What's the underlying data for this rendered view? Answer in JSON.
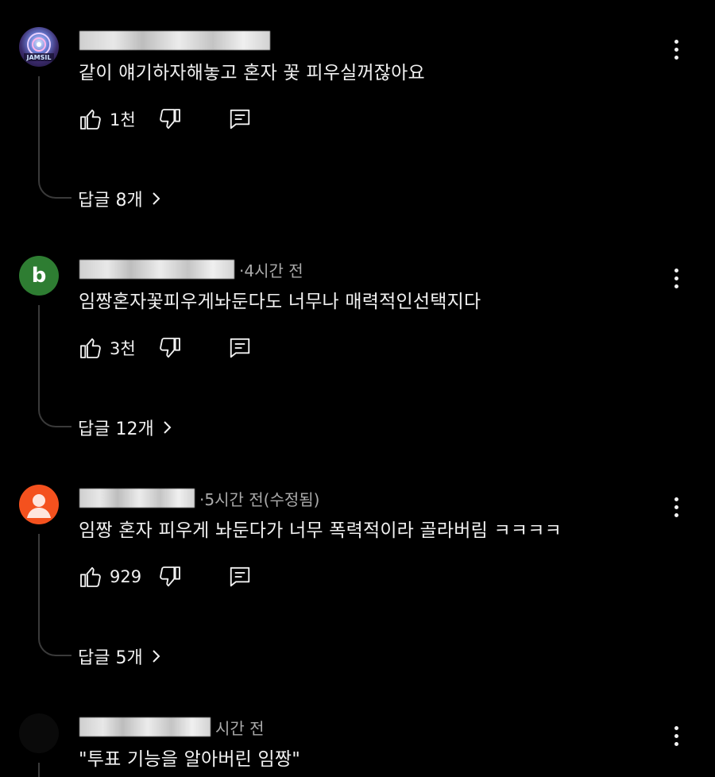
{
  "comments": [
    {
      "avatar_type": "image",
      "avatar_text": "JAMSIL",
      "meta_suffix": "",
      "text": "같이 얘기하자해놓고 혼자 꽃 피우실꺼잖아요",
      "likes": "1천",
      "replies_label": "답글 8개"
    },
    {
      "avatar_type": "letter",
      "avatar_letter": "b",
      "avatar_color": "#2e7d32",
      "meta_suffix": "·4시간 전",
      "text": "임짱혼자꽃피우게놔둔다도 너무나 매력적인선택지다",
      "likes": "3천",
      "replies_label": "답글 12개"
    },
    {
      "avatar_type": "default",
      "avatar_color": "#f4511e",
      "meta_suffix": "·5시간 전(수정됨)",
      "text": "임짱 혼자 피우게 놔둔다가 너무 폭력적이라 골라버림 ㅋㅋㅋㅋ",
      "likes": "929",
      "replies_label": "답글 5개"
    },
    {
      "avatar_type": "dark",
      "avatar_color": "#0a0a0a",
      "meta_suffix": "시간 전",
      "text": "\"투표 기능을 알아버린 임짱\""
    }
  ],
  "colors": {
    "background": "#000000",
    "text": "#f1f1f1",
    "meta": "#aaaaaa",
    "thread_line": "#3a3a3a"
  },
  "icons": {
    "like": "thumbs-up-icon",
    "dislike": "thumbs-down-icon",
    "reply": "comment-reply-icon",
    "more": "vertical-ellipsis-icon",
    "expand": "chevron-right-icon"
  }
}
